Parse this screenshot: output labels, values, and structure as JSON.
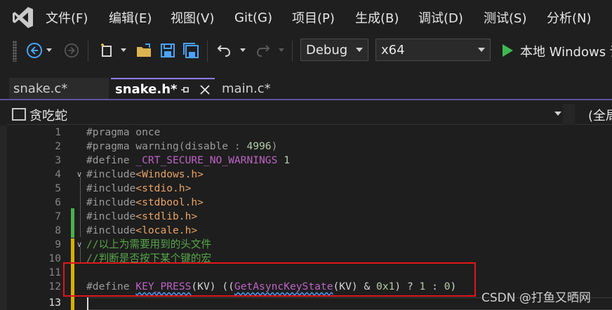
{
  "menu": {
    "items": [
      "文件(F)",
      "编辑(E)",
      "视图(V)",
      "Git(G)",
      "项目(P)",
      "生成(B)",
      "调试(D)",
      "测试(S)",
      "分析(N)"
    ]
  },
  "toolbar": {
    "config": "Debug",
    "platform": "x64",
    "run_label": "本地 Windows 调"
  },
  "tabs": [
    {
      "label": "snake.c*",
      "active": false
    },
    {
      "label": "snake.h*",
      "active": true
    },
    {
      "label": "main.c*",
      "active": false
    }
  ],
  "navbar": {
    "project": "贪吃蛇",
    "scope": "(全局"
  },
  "editor": {
    "lines": [
      {
        "n": "1",
        "text": "#pragma once"
      },
      {
        "n": "2",
        "text": "#pragma warning(disable : 4996)"
      },
      {
        "n": "3",
        "text": "#define _CRT_SECURE_NO_WARNINGS 1"
      },
      {
        "n": "4",
        "text": "#include<Windows.h>"
      },
      {
        "n": "5",
        "text": "#include<stdio.h>"
      },
      {
        "n": "6",
        "text": "#include<stdbool.h>"
      },
      {
        "n": "7",
        "text": "#include<stdlib.h>"
      },
      {
        "n": "8",
        "text": "#include<locale.h>"
      },
      {
        "n": "9",
        "text": "//以上为需要用到的头文件"
      },
      {
        "n": "10",
        "text": "//判断是否按下某个键的宏"
      },
      {
        "n": "11",
        "text": ""
      },
      {
        "n": "12",
        "text": "#define KEY_PRESS(KV) ((GetAsyncKeyState(KV) & 0x1) ? 1 : 0)"
      },
      {
        "n": "13",
        "text": ""
      }
    ]
  },
  "watermark": "CSDN @打鱼又晒网",
  "colors": {
    "accent": "#8f7cff",
    "highlight_box": "#e0161b",
    "comment": "#57a64a",
    "string": "#e8a364"
  }
}
